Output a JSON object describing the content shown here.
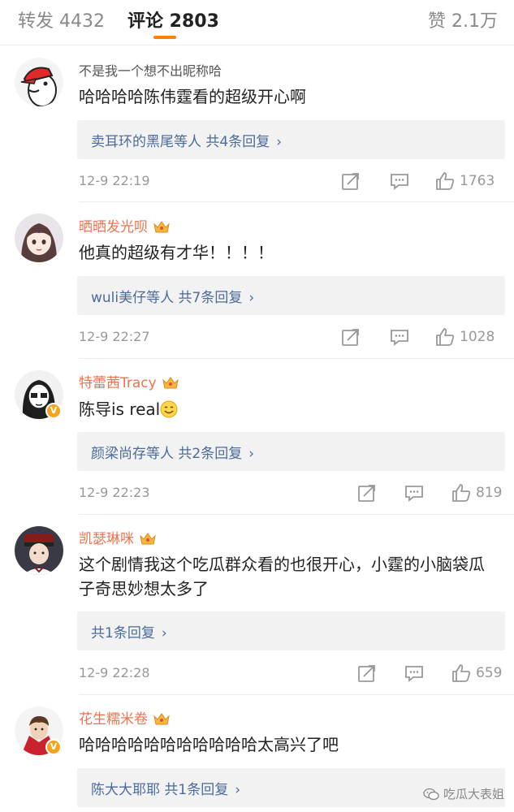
{
  "tabs": {
    "repost": "转发 4432",
    "comments": "评论 2803",
    "likes": "赞 2.1万"
  },
  "comments": [
    {
      "username": "不是我一个想不出昵称哈",
      "text": "哈哈哈哈陈伟霆看的超级开心啊",
      "replies": "卖耳环的黑尾等人  共4条回复",
      "time": "12-9 22:19",
      "likes": "1763",
      "avatar": "duck-avatar"
    },
    {
      "username": "晒晒发光呗",
      "text": "他真的超级有才华！！！！",
      "replies": "wuli美仔等人  共7条回复",
      "time": "12-9 22:27",
      "likes": "1028",
      "avatar": "anime-girl-avatar"
    },
    {
      "username": "特蕾茜Tracy",
      "text": "陈导is real",
      "replies": "颜梁尚存等人  共2条回复",
      "time": "12-9 22:23",
      "likes": "819",
      "avatar": "cartoon-girl-avatar"
    },
    {
      "username": "凯瑟琳咪",
      "text": "这个剧情我这个吃瓜群众看的也很开心，小霆的小脑袋瓜子奇思妙想太多了",
      "replies": "共1条回复",
      "time": "12-9 22:28",
      "likes": "659",
      "avatar": "soldier-avatar"
    },
    {
      "username": "花生糯米卷",
      "text": "哈哈哈哈哈哈哈哈哈哈哈太高兴了吧",
      "replies": "陈大大耶耶  共1条回复",
      "time": "",
      "likes": "",
      "avatar": "man-cape-avatar"
    }
  ],
  "watermark": "吃瓜大表姐",
  "colors": {
    "accent": "#ff8200",
    "vip_name": "#eb7350",
    "link": "#4a6b9b",
    "reply_bg": "#f2f2f2"
  }
}
